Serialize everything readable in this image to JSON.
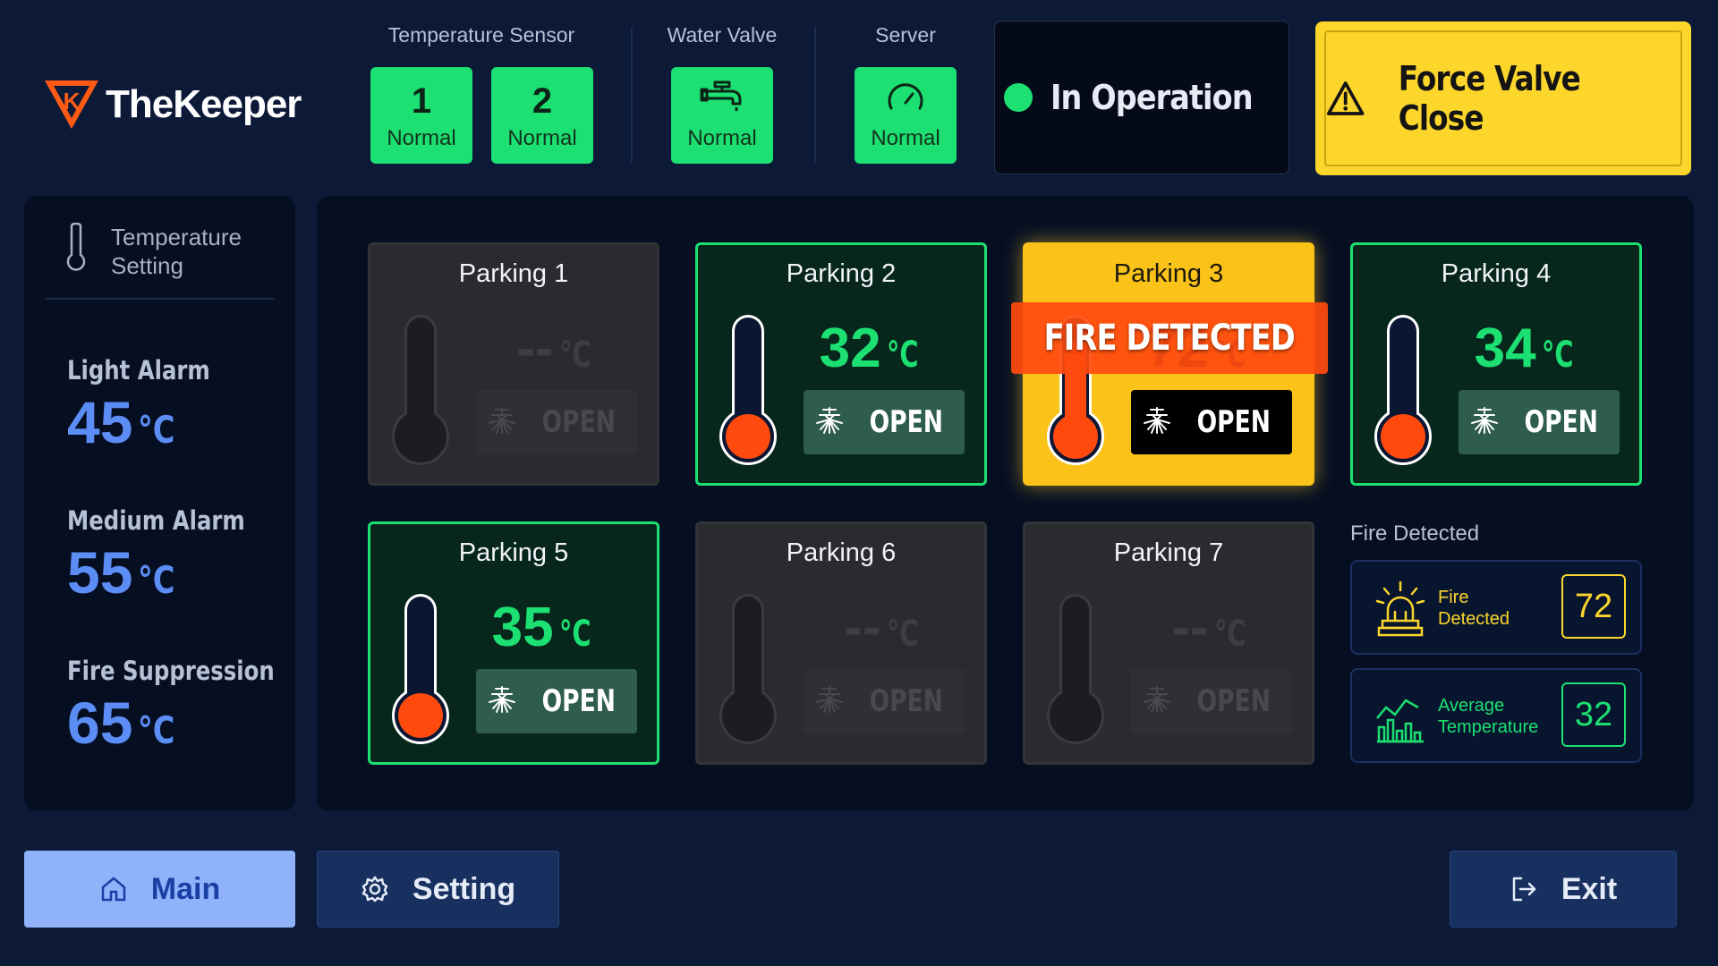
{
  "app": {
    "logo_text": "TheKeeper",
    "logo_mark_letter": "K",
    "brand_color": "#ff5a14"
  },
  "header": {
    "groups": [
      {
        "title": "Temperature Sensor",
        "tiles": [
          {
            "number": "1",
            "status": "Normal"
          },
          {
            "number": "2",
            "status": "Normal"
          }
        ]
      },
      {
        "title": "Water Valve",
        "tiles": [
          {
            "icon": "faucet-icon",
            "status": "Normal"
          }
        ]
      },
      {
        "title": "Server",
        "tiles": [
          {
            "icon": "gauge-icon",
            "status": "Normal"
          }
        ]
      }
    ],
    "operation_status": "In Operation",
    "force_button": "Force Valve Close"
  },
  "settings_panel": {
    "title": "Temperature Setting",
    "alarms": [
      {
        "name": "Light Alarm",
        "value": "45",
        "unit": "°C"
      },
      {
        "name": "Medium Alarm",
        "value": "55",
        "unit": "°C"
      },
      {
        "name": "Fire Suppression",
        "value": "65",
        "unit": "°C"
      }
    ]
  },
  "parkings": [
    {
      "name": "Parking 1",
      "state": "offline",
      "temp": "--",
      "unit": "°C",
      "valve": "OPEN"
    },
    {
      "name": "Parking 2",
      "state": "normal",
      "temp": "32",
      "unit": "°C",
      "valve": "OPEN"
    },
    {
      "name": "Parking 3",
      "state": "fire",
      "temp": "72",
      "unit": "°C",
      "valve": "OPEN",
      "banner": "FIRE DETECTED"
    },
    {
      "name": "Parking 4",
      "state": "normal",
      "temp": "34",
      "unit": "°C",
      "valve": "OPEN"
    },
    {
      "name": "Parking 5",
      "state": "normal",
      "temp": "35",
      "unit": "°C",
      "valve": "OPEN"
    },
    {
      "name": "Parking 6",
      "state": "offline",
      "temp": "--",
      "unit": "°C",
      "valve": "OPEN"
    },
    {
      "name": "Parking 7",
      "state": "offline",
      "temp": "--",
      "unit": "°C",
      "valve": "OPEN"
    }
  ],
  "summary": {
    "title": "Fire Detected",
    "fire_detected": {
      "label_line1": "Fire",
      "label_line2": "Detected",
      "value": "72",
      "icon": "siren-icon"
    },
    "average_temperature": {
      "label_line1": "Average",
      "label_line2": "Temperature",
      "value": "32",
      "icon": "chart-icon"
    }
  },
  "nav": {
    "main": "Main",
    "setting": "Setting",
    "exit": "Exit"
  },
  "colors": {
    "background": "#0c1a38",
    "normal_green": "#1ce071",
    "fire_yellow": "#fdd62c",
    "fire_orange": "#ff4a0e",
    "setting_blue": "#5b8df5"
  }
}
